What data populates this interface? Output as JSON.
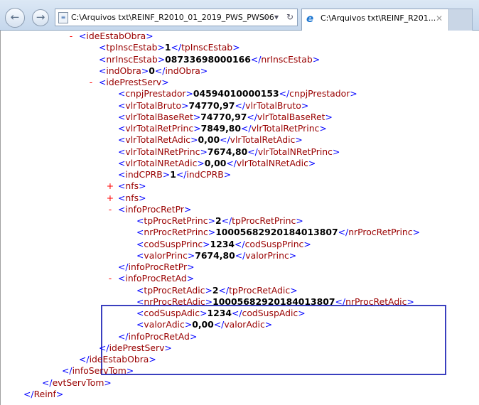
{
  "browser": {
    "back_icon": "back-arrow-icon",
    "forward_icon": "forward-arrow-icon",
    "address": "C:\\Arquivos txt\\REINF_R2010_01_2019_PWS_PWS06",
    "tab_title": "C:\\Arquivos txt\\REINF_R201...",
    "search_glyph": "⌕",
    "dropdown_glyph": "▾",
    "refresh_glyph": "↻",
    "close_glyph": "✕"
  },
  "xml_lines": [
    {
      "level": 3,
      "kind": "open",
      "toggle": "-",
      "tag": "ideEstabObra"
    },
    {
      "level": 4,
      "kind": "leaf",
      "tag": "tpInscEstab",
      "value": "1"
    },
    {
      "level": 4,
      "kind": "leaf",
      "tag": "nrInscEstab",
      "value": "08733698000166"
    },
    {
      "level": 4,
      "kind": "leaf",
      "tag": "indObra",
      "value": "0"
    },
    {
      "level": 4,
      "kind": "open",
      "toggle": "-",
      "tag": "idePrestServ"
    },
    {
      "level": 5,
      "kind": "leaf",
      "tag": "cnpjPrestador",
      "value": "04594010000153"
    },
    {
      "level": 5,
      "kind": "leaf",
      "tag": "vlrTotalBruto",
      "value": "74770,97"
    },
    {
      "level": 5,
      "kind": "leaf",
      "tag": "vlrTotalBaseRet",
      "value": "74770,97"
    },
    {
      "level": 5,
      "kind": "leaf",
      "tag": "vlrTotalRetPrinc",
      "value": "7849,80"
    },
    {
      "level": 5,
      "kind": "leaf",
      "tag": "vlrTotalRetAdic",
      "value": "0,00"
    },
    {
      "level": 5,
      "kind": "leaf",
      "tag": "vlrTotalNRetPrinc",
      "value": "7674,80"
    },
    {
      "level": 5,
      "kind": "leaf",
      "tag": "vlrTotalNRetAdic",
      "value": "0,00"
    },
    {
      "level": 5,
      "kind": "leaf",
      "tag": "indCPRB",
      "value": "1"
    },
    {
      "level": 5,
      "kind": "open",
      "toggle": "+",
      "tag": "nfs"
    },
    {
      "level": 5,
      "kind": "open",
      "toggle": "+",
      "tag": "nfs"
    },
    {
      "level": 5,
      "kind": "open",
      "toggle": "-",
      "tag": "infoProcRetPr"
    },
    {
      "level": 6,
      "kind": "leaf",
      "tag": "tpProcRetPrinc",
      "value": "2"
    },
    {
      "level": 6,
      "kind": "leaf",
      "tag": "nrProcRetPrinc",
      "value": "10005682920184013807"
    },
    {
      "level": 6,
      "kind": "leaf",
      "tag": "codSuspPrinc",
      "value": "1234"
    },
    {
      "level": 6,
      "kind": "leaf",
      "tag": "valorPrinc",
      "value": "7674,80"
    },
    {
      "level": 5,
      "kind": "close",
      "tag": "infoProcRetPr"
    },
    {
      "level": 5,
      "kind": "open",
      "toggle": "-",
      "tag": "infoProcRetAd"
    },
    {
      "level": 6,
      "kind": "leaf",
      "tag": "tpProcRetAdic",
      "value": "2"
    },
    {
      "level": 6,
      "kind": "leaf",
      "tag": "nrProcRetAdic",
      "value": "10005682920184013807"
    },
    {
      "level": 6,
      "kind": "leaf",
      "tag": "codSuspAdic",
      "value": "1234"
    },
    {
      "level": 6,
      "kind": "leaf",
      "tag": "valorAdic",
      "value": "0,00"
    },
    {
      "level": 5,
      "kind": "close",
      "tag": "infoProcRetAd"
    },
    {
      "level": 4,
      "kind": "close",
      "tag": "idePrestServ"
    },
    {
      "level": 3,
      "kind": "close",
      "tag": "ideEstabObra"
    },
    {
      "level": 2,
      "kind": "close",
      "tag": "infoServTom"
    },
    {
      "level": 1,
      "kind": "close",
      "tag": "evtServTom"
    },
    {
      "level": 0,
      "kind": "close",
      "tag": "Reinf"
    }
  ],
  "colors": {
    "bracket": "#0000ff",
    "tag": "#990000",
    "value": "#000000",
    "toggle": "#ff0000",
    "highlight_box": "#3a3fbf"
  }
}
